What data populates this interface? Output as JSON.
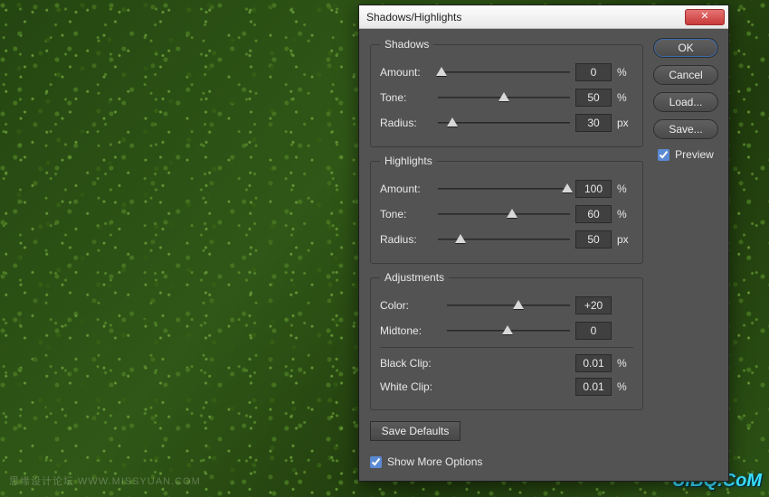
{
  "dialog": {
    "title": "Shadows/Highlights",
    "groups": {
      "shadows": {
        "legend": "Shadows",
        "amount": {
          "label": "Amount:",
          "value": "0",
          "unit": "%",
          "pct": 2.8
        },
        "tone": {
          "label": "Tone:",
          "value": "50",
          "unit": "%",
          "pct": 50
        },
        "radius": {
          "label": "Radius:",
          "value": "30",
          "unit": "px",
          "pct": 11
        }
      },
      "highlights": {
        "legend": "Highlights",
        "amount": {
          "label": "Amount:",
          "value": "100",
          "unit": "%",
          "pct": 98
        },
        "tone": {
          "label": "Tone:",
          "value": "60",
          "unit": "%",
          "pct": 56
        },
        "radius": {
          "label": "Radius:",
          "value": "50",
          "unit": "px",
          "pct": 17
        }
      },
      "adjustments": {
        "legend": "Adjustments",
        "color": {
          "label": "Color:",
          "value": "+20",
          "unit": "",
          "pct": 58
        },
        "midtone": {
          "label": "Midtone:",
          "value": "0",
          "unit": "",
          "pct": 49
        },
        "black_clip": {
          "label": "Black Clip:",
          "value": "0.01",
          "unit": "%"
        },
        "white_clip": {
          "label": "White Clip:",
          "value": "0.01",
          "unit": "%"
        }
      }
    },
    "save_defaults": "Save Defaults",
    "show_more": "Show More Options"
  },
  "buttons": {
    "ok": "OK",
    "cancel": "Cancel",
    "load": "Load...",
    "save": "Save...",
    "preview": "Preview"
  },
  "watermark": {
    "left": "思缘设计论坛  WWW.MISSYUAN.COM",
    "right": "UiBQ.CoM"
  }
}
